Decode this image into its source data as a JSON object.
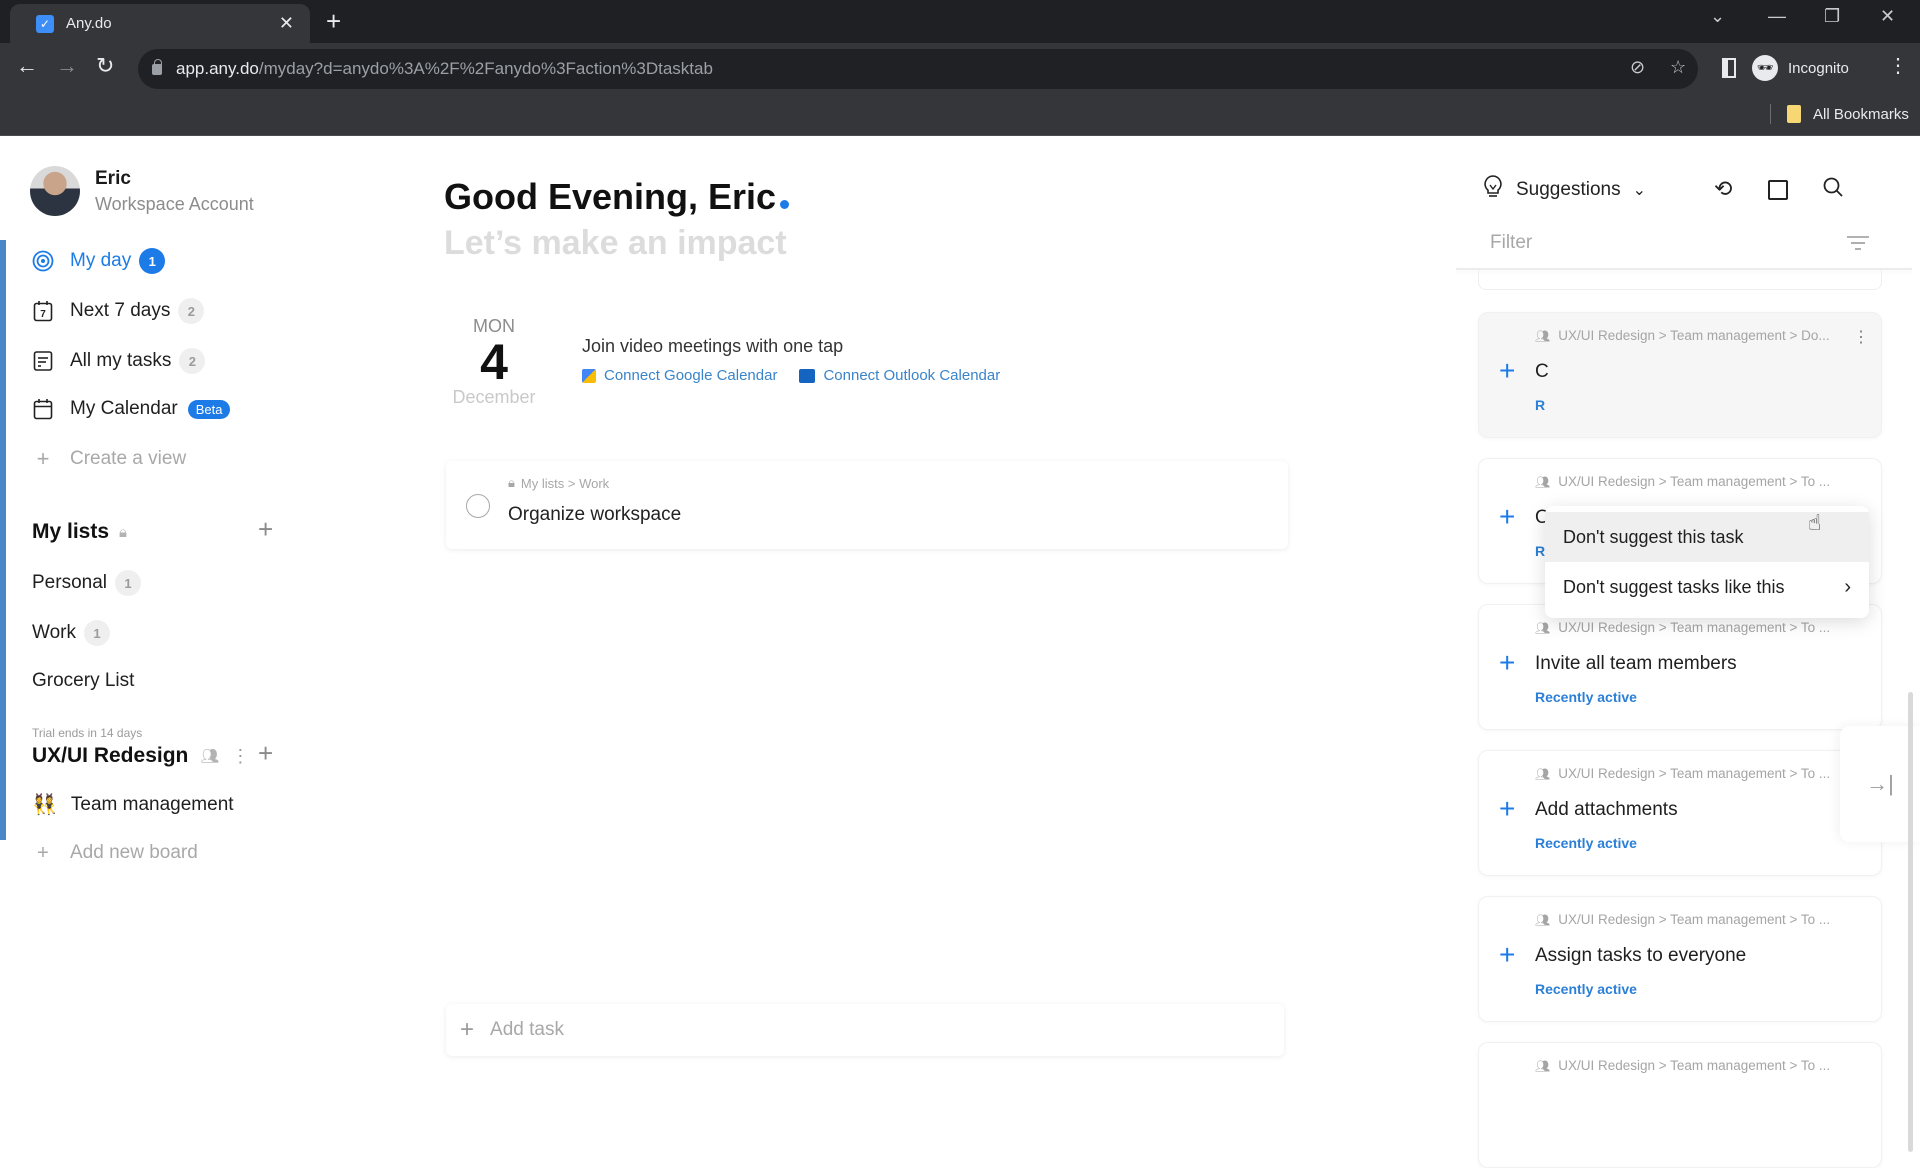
{
  "browser": {
    "tab_title": "Any.do",
    "url_host": "app.any.do",
    "url_path": "/myday?d=anydo%3A%2F%2Fanydo%3Faction%3Dtasktab",
    "profile_label": "Incognito",
    "bookmarks_label": "All Bookmarks"
  },
  "user": {
    "name": "Eric",
    "account": "Workspace Account"
  },
  "nav": [
    {
      "label": "My day",
      "count": "1",
      "icon": "target-icon"
    },
    {
      "label": "Next 7 days",
      "count": "2",
      "icon": "calendar-7-icon"
    },
    {
      "label": "All my tasks",
      "count": "2",
      "icon": "list-icon"
    },
    {
      "label": "My Calendar",
      "badge": "Beta",
      "icon": "calendar-icon"
    },
    {
      "label": "Create a view",
      "icon": "plus-icon"
    }
  ],
  "my_lists": {
    "title": "My lists",
    "items": [
      {
        "label": "Personal",
        "count": "1"
      },
      {
        "label": "Work",
        "count": "1"
      },
      {
        "label": "Grocery List"
      }
    ]
  },
  "workspace": {
    "trial": "Trial ends in 14 days",
    "title": "UX/UI Redesign",
    "boards": [
      {
        "label": "Team management",
        "emoji": "👯"
      }
    ],
    "add_board": "Add new board"
  },
  "main": {
    "greeting": "Good Evening, Eric",
    "subtitle": "Let’s make an impact",
    "date": {
      "dow": "MON",
      "day": "4",
      "month": "December"
    },
    "meetings": {
      "text": "Join video meetings with one tap",
      "google": "Connect Google Calendar",
      "outlook": "Connect Outlook Calendar"
    },
    "tasks": [
      {
        "crumb": "My lists > Work",
        "title": "Organize workspace"
      }
    ],
    "add_task_placeholder": "Add task"
  },
  "suggestions": {
    "header": "Suggestions",
    "filter_placeholder": "Filter",
    "cards": [
      {
        "crumb": "UX/UI Redesign > Team management > Do...",
        "title": "C",
        "tag": "R"
      },
      {
        "crumb": "UX/UI Redesign > Team management > To ...",
        "title": "Overview everyone's work",
        "tag": "Recently active"
      },
      {
        "crumb": "UX/UI Redesign > Team management > To ...",
        "title": "Invite all team members",
        "tag": "Recently active"
      },
      {
        "crumb": "UX/UI Redesign > Team management > To ...",
        "title": "Add attachments",
        "tag": "Recently active"
      },
      {
        "crumb": "UX/UI Redesign > Team management > To ...",
        "title": "Assign tasks to everyone",
        "tag": "Recently active"
      },
      {
        "crumb": "UX/UI Redesign > Team management > To ..."
      }
    ],
    "context_menu": [
      {
        "label": "Don't suggest this task"
      },
      {
        "label": "Don't suggest tasks like this"
      }
    ]
  },
  "colors": {
    "accent": "#1d7be8",
    "sidebar_bar": "#4a86c8",
    "tag": "#2b7fd6"
  }
}
